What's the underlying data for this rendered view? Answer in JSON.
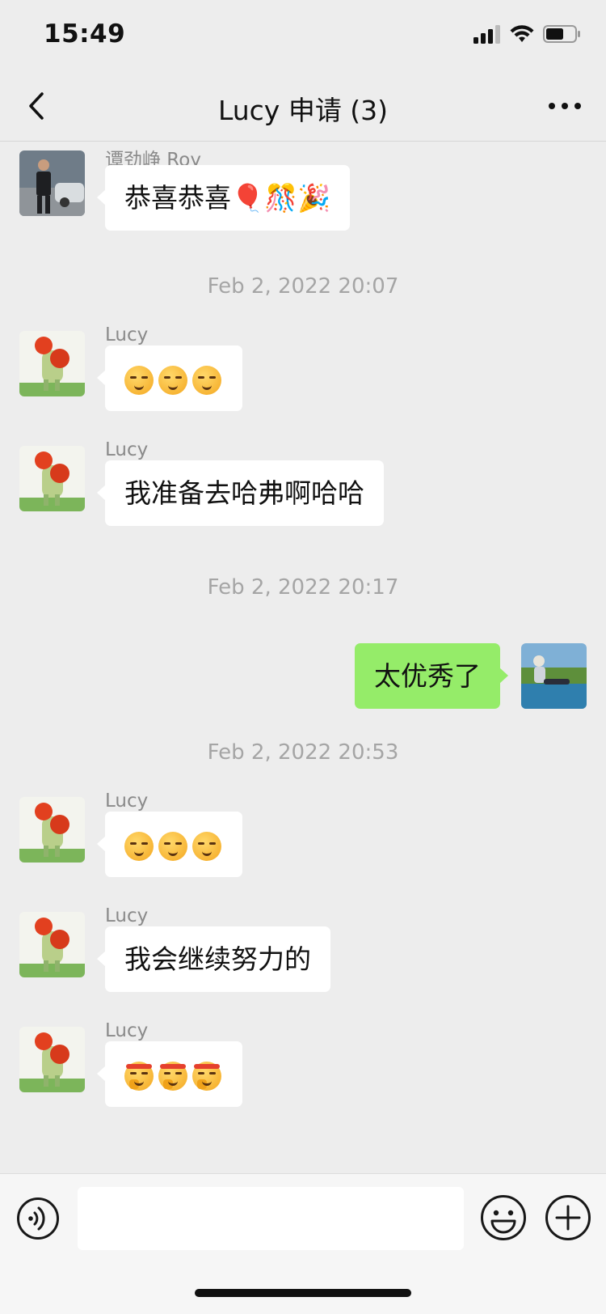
{
  "status_bar": {
    "time": "15:49"
  },
  "nav": {
    "title": "Lucy 申请 (3)",
    "back_icon": "chevron-left-icon",
    "more_icon": "more-horizontal-icon"
  },
  "messages": [
    {
      "kind": "incoming",
      "sender": "谭劲峥 Roy",
      "text": "恭喜恭喜🎈🎊🎉"
    },
    {
      "kind": "timestamp",
      "text": "Feb 2, 2022 20:07"
    },
    {
      "kind": "incoming",
      "sender": "Lucy",
      "emoji": "smirk-face-icon x3"
    },
    {
      "kind": "incoming",
      "sender": "Lucy",
      "text": "我准备去哈弗啊哈哈"
    },
    {
      "kind": "timestamp",
      "text": "Feb 2, 2022 20:17"
    },
    {
      "kind": "outgoing",
      "text": "太优秀了"
    },
    {
      "kind": "timestamp",
      "text": "Feb 2, 2022 20:53"
    },
    {
      "kind": "incoming",
      "sender": "Lucy",
      "emoji": "smirk-face-icon x3"
    },
    {
      "kind": "incoming",
      "sender": "Lucy",
      "text": "我会继续努力的"
    },
    {
      "kind": "incoming",
      "sender": "Lucy",
      "emoji": "determined-face-icon x3"
    }
  ],
  "input_bar": {
    "voice_icon": "voice-icon",
    "text_value": "",
    "emoji_icon": "emoji-icon",
    "plus_icon": "plus-icon"
  },
  "colors": {
    "background": "#ededed",
    "incoming_bubble": "#ffffff",
    "outgoing_bubble": "#95ec69",
    "timestamp": "#a5a5a5"
  }
}
